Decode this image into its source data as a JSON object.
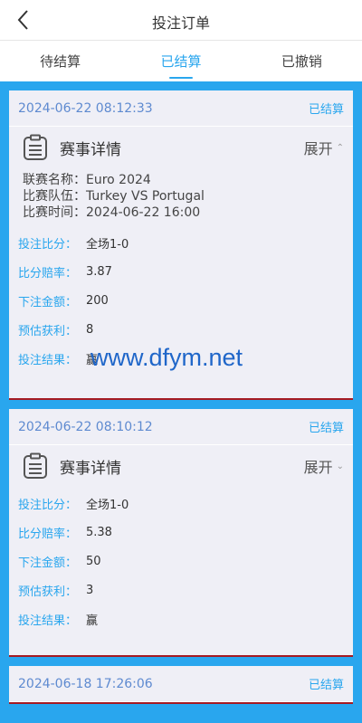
{
  "header": {
    "title": "投注订单",
    "back_icon": "chevron-left-icon"
  },
  "tabs": [
    {
      "label": "待结算",
      "active": false
    },
    {
      "label": "已结算",
      "active": true
    },
    {
      "label": "已撤销",
      "active": false
    }
  ],
  "colors": {
    "accent": "#29a6ee",
    "divider": "#a51a22",
    "card_bg": "#efeff6"
  },
  "cards": [
    {
      "time": "2024-06-22 08:12:33",
      "status": "已结算",
      "detail_title": "赛事详情",
      "expand_label": "展开",
      "expand_icon": "chevron-up-icon",
      "info": [
        "联赛名称：Euro 2024",
        "比赛队伍：Turkey VS Portugal",
        "比赛时间：2024-06-22 16:00"
      ],
      "fields": [
        {
          "label": "投注比分：",
          "value": "全场1-0"
        },
        {
          "label": "比分赔率：",
          "value": "3.87"
        },
        {
          "label": "下注金额：",
          "value": "200"
        },
        {
          "label": "预估获利：",
          "value": "8"
        },
        {
          "label": "投注结果：",
          "value": "赢"
        }
      ]
    },
    {
      "time": "2024-06-22 08:10:12",
      "status": "已结算",
      "detail_title": "赛事详情",
      "expand_label": "展开",
      "expand_icon": "chevron-down-icon",
      "fields": [
        {
          "label": "投注比分：",
          "value": "全场1-0"
        },
        {
          "label": "比分赔率：",
          "value": "5.38"
        },
        {
          "label": "下注金额：",
          "value": "50"
        },
        {
          "label": "预估获利：",
          "value": "3"
        },
        {
          "label": "投注结果：",
          "value": "赢"
        }
      ]
    },
    {
      "time": "2024-06-18 17:26:06",
      "status": "已结算"
    }
  ],
  "watermark": "www.dfym.net"
}
